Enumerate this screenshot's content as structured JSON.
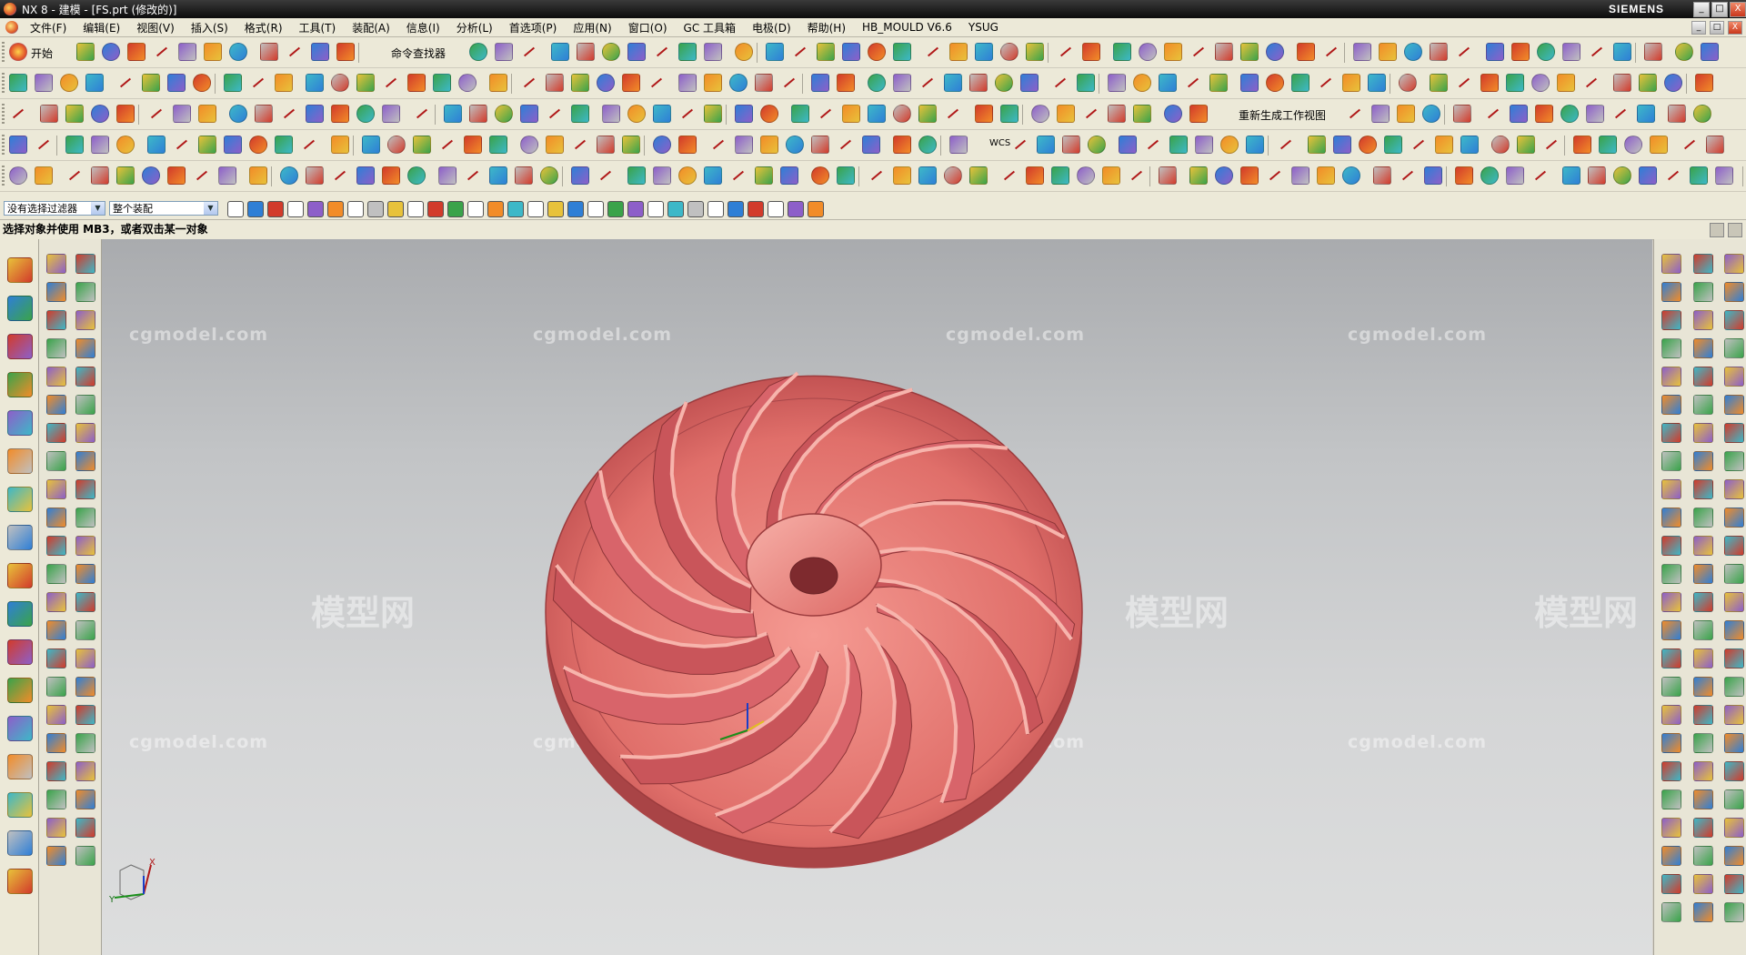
{
  "window": {
    "title": "NX 8 - 建模 - [FS.prt (修改的)]",
    "brand": "SIEMENS",
    "controls": [
      "_",
      "□",
      "X"
    ]
  },
  "menu": {
    "items": [
      "文件(F)",
      "编辑(E)",
      "视图(V)",
      "插入(S)",
      "格式(R)",
      "工具(T)",
      "装配(A)",
      "信息(I)",
      "分析(L)",
      "首选项(P)",
      "窗口(O)",
      "GC 工具箱",
      "电极(D)",
      "帮助(H)",
      "HB_MOULD V6.6",
      "YSUG",
      "应用(N)"
    ]
  },
  "toolbar": {
    "start_label": "开始",
    "command_finder_label": "命令查找器",
    "regenerate_view_label": "重新生成工作视图",
    "wcs_label": "WCS"
  },
  "selection": {
    "filter_value": "没有选择过滤器",
    "scope_value": "整个装配"
  },
  "status": {
    "prompt": "选择对象并使用 MB3，或者双击某一对象"
  },
  "viewport": {
    "model": "impeller",
    "model_color": "#e8706c",
    "watermark_url": "cgmodel.com",
    "watermark_logo": "模型网",
    "triad_labels": {
      "x": "X",
      "y": "Y"
    }
  },
  "icons": {
    "row_colors": [
      "#e8c23a",
      "#2f7fd6",
      "#d23b2b",
      "#3aa34a",
      "#8d5fc9",
      "#f28c28",
      "#3db8c8",
      "#c0c0c0"
    ]
  }
}
